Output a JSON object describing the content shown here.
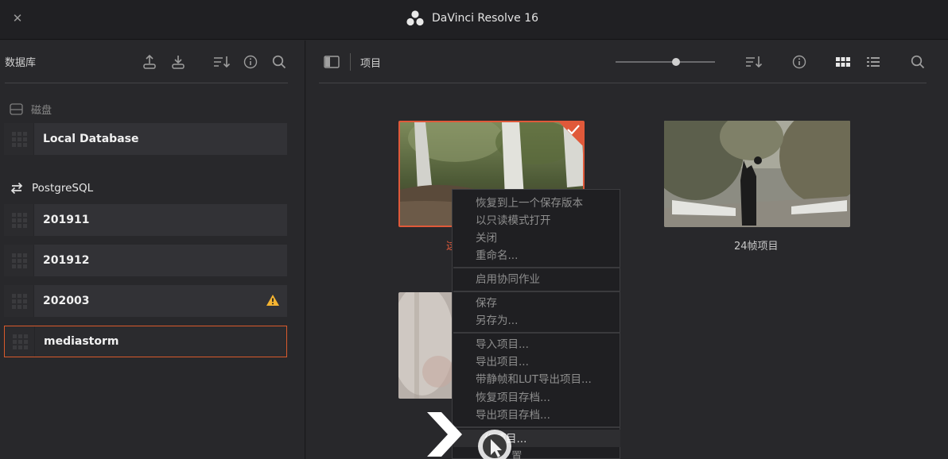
{
  "window": {
    "title": "DaVinci Resolve 16",
    "close_glyph": "✕"
  },
  "left": {
    "title": "数据库",
    "icons": [
      "upload-icon",
      "download-icon",
      "sort-icon",
      "info-icon",
      "search-icon"
    ],
    "disk_label": "磁盘",
    "local_db": "Local Database",
    "postgres_label": "PostgreSQL",
    "databases": [
      "201911",
      "201912",
      "202003",
      "mediastorm"
    ],
    "warning_db": "202003",
    "active_db": "mediastorm"
  },
  "main": {
    "title": "项目",
    "projects": [
      {
        "label": "",
        "selected": true
      },
      {
        "label": "24帧项目",
        "selected": false
      },
      {
        "label": "",
        "selected": false
      }
    ],
    "partial_label_char": "这"
  },
  "context_menu": {
    "groups": [
      [
        "恢复到上一个保存版本",
        "以只读模式打开",
        "关闭",
        "重命名..."
      ],
      [
        "启用协同作业"
      ],
      [
        "保存",
        "另存为..."
      ],
      [
        "导入项目...",
        "导出项目...",
        "带静帧和LUT导出项目...",
        "恢复项目存档...",
        "导出项目存档..."
      ],
      [
        "备份项目...",
        "项目设置"
      ]
    ],
    "hovered_item": "备份项目...",
    "hovered_visible": "份项目...",
    "last_visible": "置"
  },
  "colors": {
    "accent": "#e0593a",
    "warning": "#f5b431",
    "bg": "#28282b"
  }
}
